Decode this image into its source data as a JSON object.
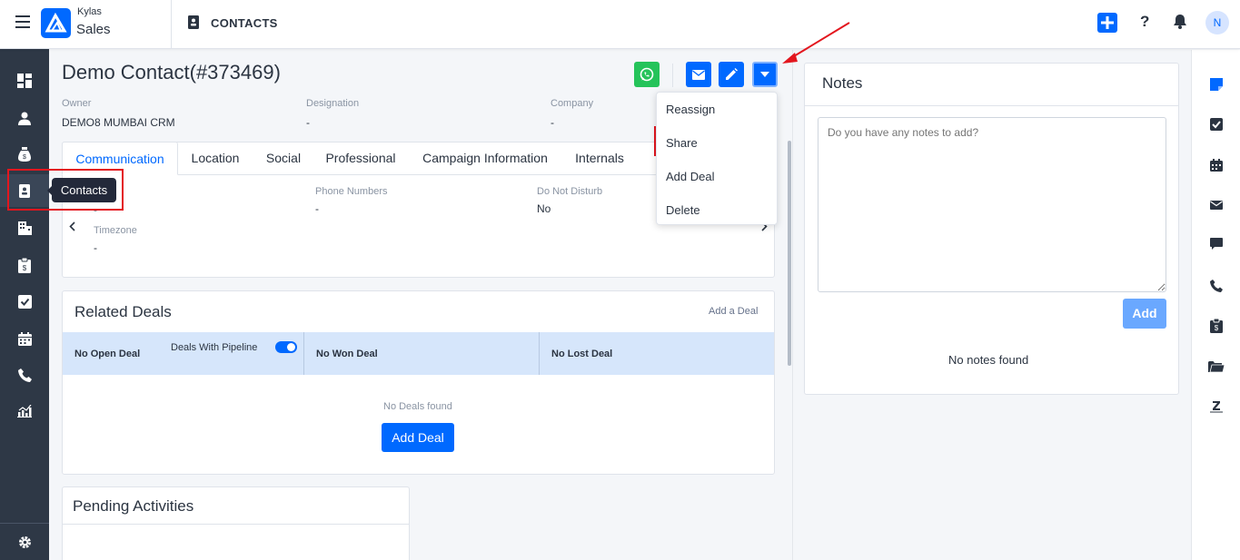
{
  "app": {
    "brand_top": "Kylas",
    "brand_bottom": "Sales",
    "breadcrumb": "CONTACTS",
    "avatar_initial": "N",
    "help_label": "?"
  },
  "tooltip": "Contacts",
  "contact": {
    "title": "Demo Contact(#373469)",
    "fields": [
      {
        "label": "Owner",
        "value": "DEMO8 MUMBAI CRM"
      },
      {
        "label": "Designation",
        "value": "-"
      },
      {
        "label": "Company",
        "value": "-"
      }
    ]
  },
  "tabs": [
    "Communication",
    "Location",
    "Social",
    "Professional",
    "Campaign Information",
    "Internals"
  ],
  "communication": {
    "phone_label": "Phone Numbers",
    "phone_value": "-",
    "dnd_label": "Do Not Disturb",
    "dnd_value": "No",
    "timezone_label": "Timezone",
    "timezone_value": "-",
    "first_value": "-"
  },
  "dropdown": [
    "Reassign",
    "Share",
    "Add Deal",
    "Delete"
  ],
  "related_deals": {
    "title": "Related Deals",
    "add_link": "Add a Deal",
    "columns": [
      "No Open Deal",
      "No Won Deal",
      "No Lost Deal"
    ],
    "pipeline_label": "Deals With Pipeline",
    "empty": "No Deals found",
    "button": "Add Deal"
  },
  "pending": {
    "title": "Pending Activities"
  },
  "notes": {
    "title": "Notes",
    "placeholder": "Do you have any notes to add?",
    "add_button": "Add",
    "empty": "No notes found"
  },
  "colors": {
    "primary": "#0069ff",
    "whatsapp": "#25c35a",
    "highlight": "#e3161e",
    "nav_bg": "#2e3846"
  }
}
